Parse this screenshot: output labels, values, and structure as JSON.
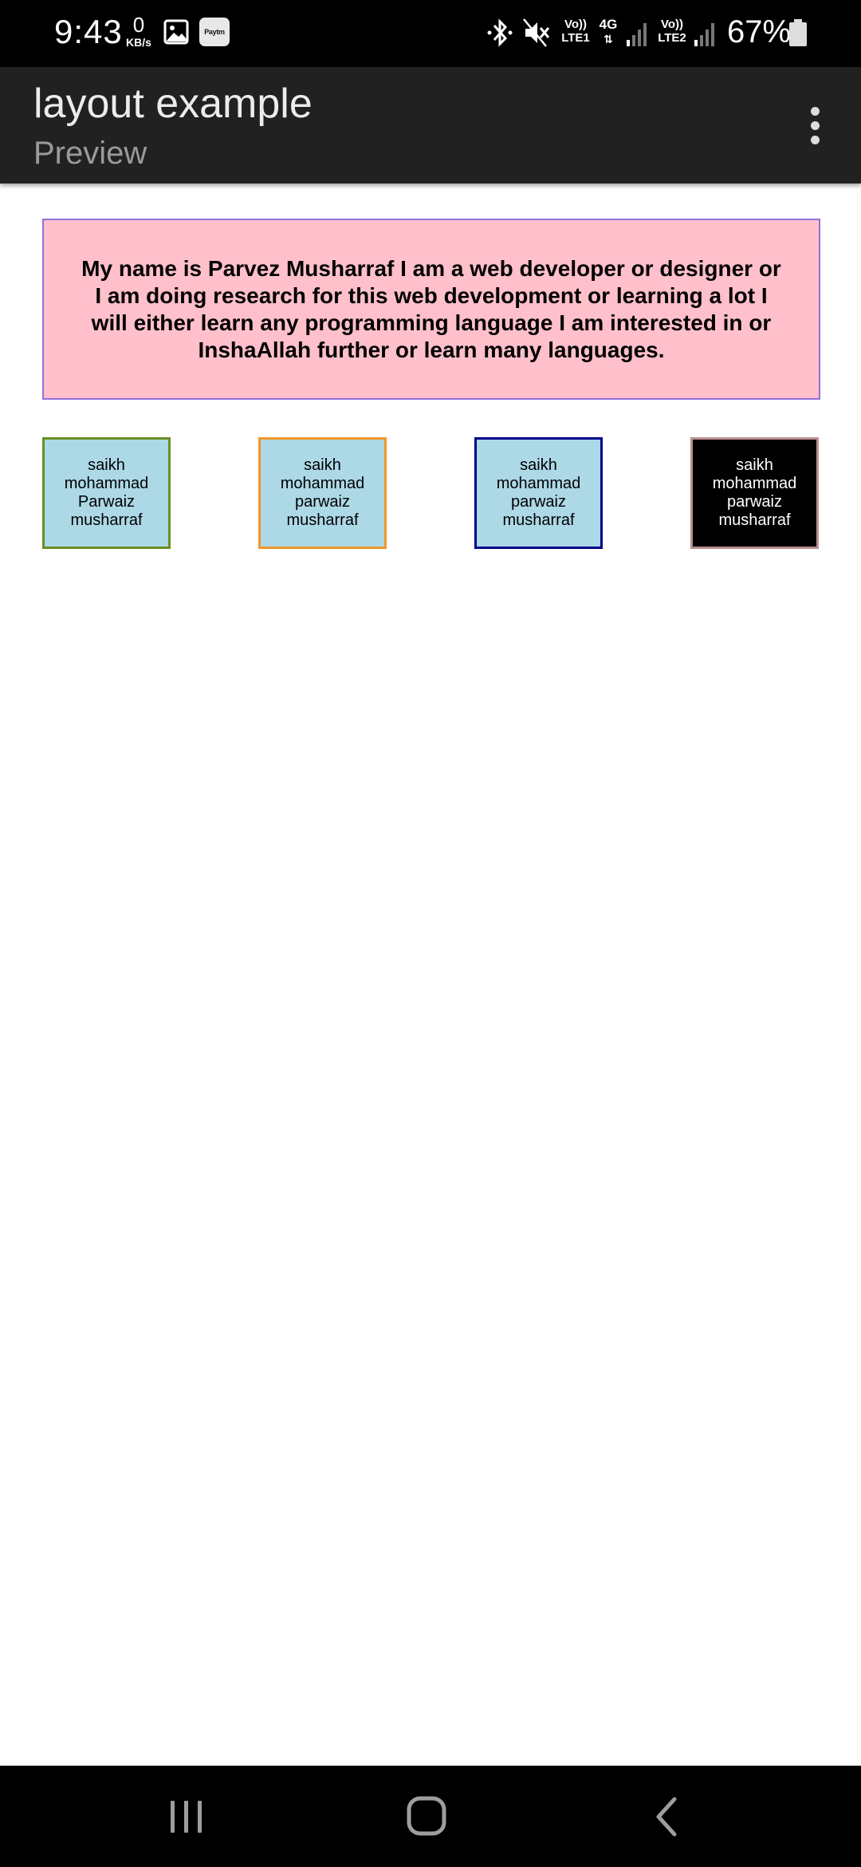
{
  "status_bar": {
    "time": "9:43",
    "net_speed_value": "0",
    "net_speed_unit": "KB/s",
    "paytm_label": "Paytm",
    "sim1_label_top": "Vo))",
    "sim1_label_bottom": "LTE1",
    "network_type": "4G",
    "sim2_label_top": "Vo))",
    "sim2_label_bottom": "LTE2",
    "battery_percent": "67%",
    "icons": [
      "gallery-icon",
      "paytm-icon",
      "bluetooth-icon",
      "mute-icon",
      "signal-icon",
      "battery-icon"
    ]
  },
  "app_bar": {
    "title": "layout example",
    "subtitle": "Preview",
    "menu_icon": "overflow-menu-icon"
  },
  "content": {
    "intro_text": "My name is Parvez Musharraf I am a web developer or designer or I am doing research for this web development or learning a lot I will either learn any programming language I am interested in or InshaAllah further or learn many languages.",
    "intro_colors": {
      "background": "#ffc0cb",
      "border": "#9370db"
    },
    "name_boxes": [
      {
        "text": "saikh mohammad Parwaiz musharraf",
        "background": "#add8e6",
        "border": "#6b8e23"
      },
      {
        "text": "saikh mohammad parwaiz musharraf",
        "background": "#add8e6",
        "border": "#f0962a"
      },
      {
        "text": "saikh mohammad parwaiz musharraf",
        "background": "#add8e6",
        "border": "#00008b"
      },
      {
        "text": "saikh mohammad parwaiz musharraf",
        "background": "#000000",
        "border": "#bc8f8f"
      }
    ]
  },
  "nav_bar": {
    "buttons": [
      "recent-apps-icon",
      "home-icon",
      "back-icon"
    ]
  }
}
